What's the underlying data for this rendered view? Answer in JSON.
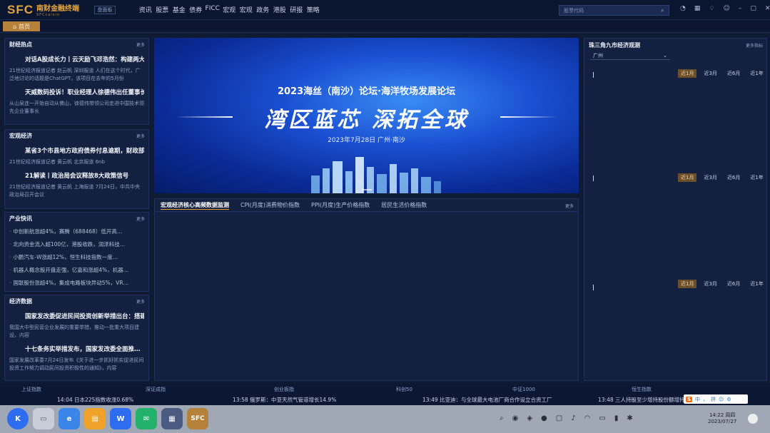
{
  "app": {
    "logo_sfc": "SFC",
    "logo_cn": "南财金融终端",
    "logo_en": "SFCcaixin",
    "board_label": "盘面板"
  },
  "nav": [
    "资讯",
    "股票",
    "基金",
    "债券",
    "FICC",
    "宏观",
    "宏观",
    "政务",
    "港股",
    "研报",
    "策略"
  ],
  "search": {
    "placeholder": "股票代码"
  },
  "home_tab": "首页",
  "panels": {
    "hot": {
      "title": "财经热点",
      "more": "更多",
      "items": [
        {
          "headline": "对话A股成长力丨云天励飞邓浩然：构建两大…",
          "desc": "21世纪经济报道记者 赵云帆 深圳报道 人们在这个时代，广泛地讨论的话题是ChatGPT，该项目在去年的5月份"
        },
        {
          "headline": "天威数码投诉！职业经理人徐德伟出任董事长…",
          "desc": "从山泉连一开始自动从佛山，徐德伟带领公司走进中国技术领先企业董事长"
        }
      ]
    },
    "macro": {
      "title": "宏观经济",
      "more": "更多",
      "items": [
        {
          "headline": "某省3个市县地方政府债券付息逾期，财政部…",
          "desc": "21世纪经济报道记者 黄云帆 北京报道 6nb"
        },
        {
          "headline": "21解读丨政治局会议释放8大政策信号",
          "desc": "21世纪经济报道记者 黄云帆 上海报道 7月24日，中共中央政治局召开会议"
        }
      ]
    },
    "industry": {
      "title": "产业快讯",
      "more": "更多",
      "items": [
        "中创新航涨超4%，赛腾（688468）低开高…",
        "北向资金流入超100亿，港股收跌，润泽科技…",
        "小鹏汽车-W涨超12%，恒生科技指数一度…",
        "机器人概念股开盘走强，亿嘉和涨超4%，机器…",
        "国联股份涨超4%，集成电路板块异动5%，VR…"
      ]
    },
    "data": {
      "title": "经济数据",
      "more": "更多",
      "items": [
        {
          "headline": "国家发改委促进民间投资创新举措出台：搭建…",
          "desc": "我国大中型民营企业发展的重要举措，推动一批重大项目建设，内容"
        },
        {
          "headline": "十七条务实举措发布，国家发改委全面推…",
          "desc": "国家发展改革委7月24日发布《关于进一步抓好抓实促进民间投资工作努力调动民间投资积极性的通知》，内容"
        }
      ]
    }
  },
  "banner": {
    "title": "2023海丝（南沙）论坛·海洋牧场发展论坛",
    "slogan": "湾区蓝芯  深拓全球",
    "meta": "2023年7月28日        广州·南沙"
  },
  "indicators": {
    "tabs": [
      "宏观经济核心高频数据监测",
      "CPI(月度)消费物价指数",
      "PPI(月度)生产价格指数",
      "居民生活价格指数"
    ],
    "more": "更多"
  },
  "right": {
    "title": "珠三角九市经济观测",
    "more": "更多指标",
    "city": "广州",
    "ranges": [
      "近1月",
      "近3月",
      "近6月",
      "近1年"
    ]
  },
  "ticker": {
    "indices": [
      "上证指数",
      "深证成指",
      "创业板指",
      "科创50",
      "中证1000",
      "恒生指数"
    ],
    "news": [
      "14:04 日本225指数收涨0.68%",
      "13:58 俄罗斯：中亚天然气管道增长14.9%",
      "13:49 比亚迪：与全球最大电池厂商合作设立合资工厂",
      "13:48 三人持股至少增持股份额增持"
    ]
  },
  "taskbar": {
    "apps": [
      "K",
      "▭",
      "e",
      "▤",
      "W",
      "✉",
      "▦",
      "SFC"
    ],
    "time": "14:22 周四",
    "date": "2023/07/27",
    "ime": [
      "S",
      "中",
      "，",
      "拼",
      "☺",
      "⚙"
    ]
  }
}
